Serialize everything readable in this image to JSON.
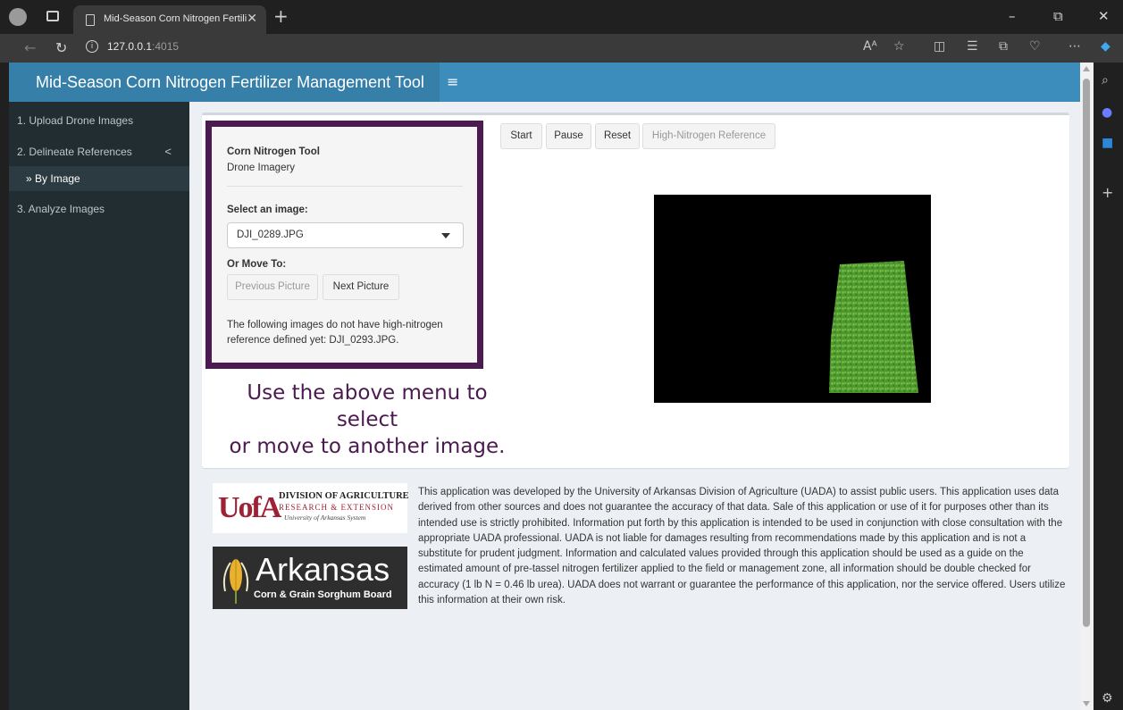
{
  "browser": {
    "tab_title": "Mid-Season Corn Nitrogen Fertili",
    "tab_close": "✕",
    "new_tab": "+",
    "url_host": "127.0.0.1",
    "url_port": ":4015",
    "window_controls": {
      "minimize": "–",
      "restore": "⧉",
      "close": "✕"
    }
  },
  "app": {
    "title": "Mid-Season Corn Nitrogen Fertilizer Management Tool",
    "accent_color": "#3c8dbc",
    "frame_color": "#4b1a50"
  },
  "sidebar": {
    "items": [
      {
        "label": "1. Upload Drone Images"
      },
      {
        "label": "2. Delineate References"
      },
      {
        "label": "By Image"
      },
      {
        "label": "3. Analyze Images"
      }
    ],
    "chevron": "<",
    "sub_prefix": "»"
  },
  "toolbar": {
    "start": "Start",
    "pause": "Pause",
    "reset": "Reset",
    "high_n_ref": "High-Nitrogen Reference"
  },
  "panel": {
    "title": "Corn Nitrogen Tool",
    "subtitle": "Drone Imagery",
    "select_label": "Select an image:",
    "selected_image": "DJI_0289.JPG",
    "move_label": "Or Move To:",
    "prev_button": "Previous Picture",
    "next_button": "Next Picture",
    "note": "The following images do not have high-nitrogen reference defined yet: DJI_0293.JPG."
  },
  "instructions": {
    "line1": "Use the above menu to select",
    "line2": "or move to another image."
  },
  "footer": {
    "uofa_mark": "UofA",
    "uofa_line1": "DIVISION OF AGRICULTURE",
    "uofa_line2": "RESEARCH & EXTENSION",
    "uofa_line3": "University of Arkansas System",
    "ark_word": "Arkansas",
    "ark_sub": "Corn & Grain Sorghum Board",
    "disclaimer": "This application was developed by the University of Arkansas Division of Agriculture (UADA) to assist public users. This application uses data derived from other sources and does not guarantee the accuracy of that data. Sale of this application or use of it for purposes other than its intended use is strictly prohibited. Information put forth by this application is intended to be used in conjunction with close consultation with the appropriate UADA professional. UADA is not liable for damages resulting from recommendations made by this application and is not a substitute for prudent judgment. Information and calculated values provided through this application should be used as a guide on the estimated amount of pre-tassel nitrogen fertilizer applied to the field or management zone, all information should be double checked for accuracy (1 lb N = 0.46 lb urea). UADA does not warrant or guarantee the performance of this application, nor the service offered. Users utilize this information at their own risk."
  }
}
